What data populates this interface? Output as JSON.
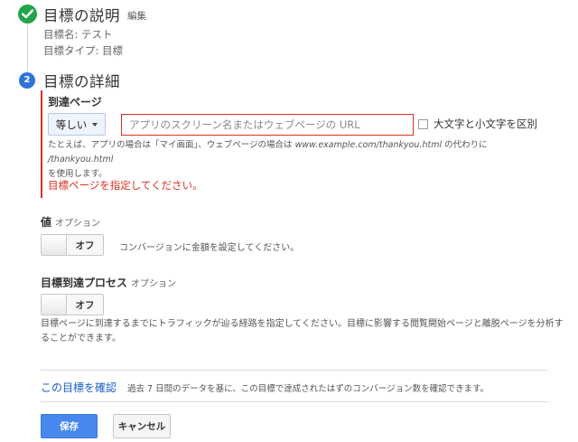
{
  "step1": {
    "title": "目標の説明",
    "edit_label": "編集",
    "goal_name": "目標名: テスト",
    "goal_type": "目標タイプ: 目標"
  },
  "step2": {
    "number": "2",
    "title": "目標の詳細",
    "destination": {
      "label": "到達ページ",
      "match_type": "等しい",
      "url_placeholder": "アプリのスクリーン名またはウェブページの URL",
      "case_sensitive_label": "大文字と小文字を区別",
      "help_line1_a": "たとえば、アプリの場合は「マイ画面」、ウェブページの場合は ",
      "help_example_url": "www.example.com/thankyou.html",
      "help_line1_b": " の代わりに ",
      "help_example_path": "/thankyou.html",
      "help_line2": "を使用します。",
      "error": "目標ページを指定してください。"
    },
    "value": {
      "label": "値",
      "optional": "オプション",
      "toggle": "オフ",
      "description": "コンバージョンに金額を設定してください。"
    },
    "funnel": {
      "label": "目標到達プロセス",
      "optional": "オプション",
      "toggle": "オフ",
      "description_line1": "目標ページに到達するまでにトラフィックが辿る経路を指定してください。目標に影響する閲覧開始ページと離脱ページを分析す",
      "description_line2": "ることができます。"
    }
  },
  "verify": {
    "link": "この目標を確認",
    "description": "過去 7 日間のデータを基に、この目標で達成されたはずのコンバージョン数を確認できます。"
  },
  "actions": {
    "save": "保存",
    "cancel": "キャンセル"
  },
  "colors": {
    "success": "#23a34a",
    "step_active": "#2f74d9",
    "error": "#d93025",
    "link": "#1a5fc2",
    "primary_button": "#4787ee"
  }
}
